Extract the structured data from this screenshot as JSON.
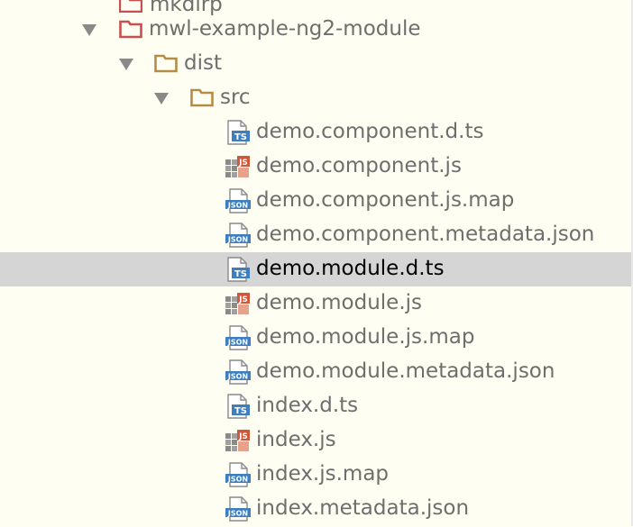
{
  "colors": {
    "background": "#fffef2",
    "selection": "#d5d5d5",
    "module_folder": "#c85050",
    "folder": "#b48c46",
    "ts": "#3c7ec0",
    "js": "#d0563a",
    "json": "#3c7ec0"
  },
  "tree": {
    "partial_top": {
      "label": "mkdirp",
      "icon": "module-folder-icon"
    },
    "module": {
      "label": "mwl-example-ng2-module",
      "icon": "module-folder-icon"
    },
    "dist": {
      "label": "dist",
      "icon": "folder-icon"
    },
    "src": {
      "label": "src",
      "icon": "folder-icon"
    },
    "files": [
      {
        "label": "demo.component.d.ts",
        "type": "ts"
      },
      {
        "label": "demo.component.js",
        "type": "js"
      },
      {
        "label": "demo.component.js.map",
        "type": "json"
      },
      {
        "label": "demo.component.metadata.json",
        "type": "json"
      },
      {
        "label": "demo.module.d.ts",
        "type": "ts",
        "selected": true
      },
      {
        "label": "demo.module.js",
        "type": "js"
      },
      {
        "label": "demo.module.js.map",
        "type": "json"
      },
      {
        "label": "demo.module.metadata.json",
        "type": "json"
      },
      {
        "label": "index.d.ts",
        "type": "ts"
      },
      {
        "label": "index.js",
        "type": "js"
      },
      {
        "label": "index.js.map",
        "type": "json"
      },
      {
        "label": "index.metadata.json",
        "type": "json"
      }
    ],
    "icon_badges": {
      "ts": "TS",
      "js": "JS",
      "json": "JSON"
    }
  }
}
